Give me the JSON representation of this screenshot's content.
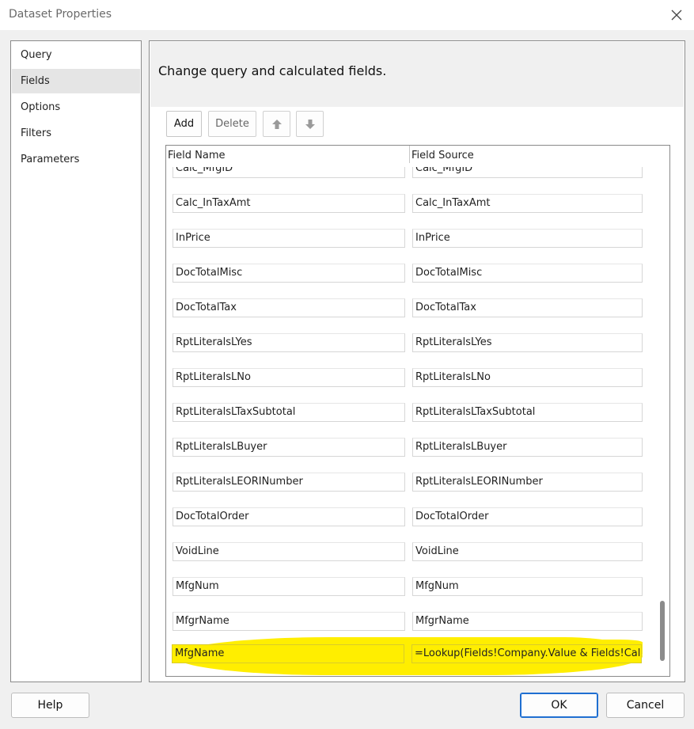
{
  "window": {
    "title": "Dataset Properties"
  },
  "nav": {
    "items": [
      {
        "label": "Query"
      },
      {
        "label": "Fields",
        "selected": true
      },
      {
        "label": "Options"
      },
      {
        "label": "Filters"
      },
      {
        "label": "Parameters"
      }
    ]
  },
  "panel": {
    "header": "Change query and calculated fields."
  },
  "toolbar": {
    "add_label": "Add",
    "delete_label": "Delete",
    "move_up_icon": "arrow-up-icon",
    "move_down_icon": "arrow-down-icon"
  },
  "grid": {
    "columns": {
      "name": "Field Name",
      "source": "Field Source"
    },
    "rows": [
      {
        "name": "Calc_MfgID",
        "source": "Calc_MfgID"
      },
      {
        "name": "Calc_InTaxAmt",
        "source": "Calc_InTaxAmt"
      },
      {
        "name": "InPrice",
        "source": "InPrice"
      },
      {
        "name": "DocTotalMisc",
        "source": "DocTotalMisc"
      },
      {
        "name": "DocTotalTax",
        "source": "DocTotalTax"
      },
      {
        "name": "RptLiteralsLYes",
        "source": "RptLiteralsLYes"
      },
      {
        "name": "RptLiteralsLNo",
        "source": "RptLiteralsLNo"
      },
      {
        "name": "RptLiteralsLTaxSubtotal",
        "source": "RptLiteralsLTaxSubtotal"
      },
      {
        "name": "RptLiteralsLBuyer",
        "source": "RptLiteralsLBuyer"
      },
      {
        "name": "RptLiteralsLEORINumber",
        "source": "RptLiteralsLEORINumber"
      },
      {
        "name": "DocTotalOrder",
        "source": "DocTotalOrder"
      },
      {
        "name": "VoidLine",
        "source": "VoidLine"
      },
      {
        "name": "MfgNum",
        "source": "MfgNum"
      },
      {
        "name": "MfgrName",
        "source": "MfgrName"
      },
      {
        "name": "MfgName",
        "source": "=Lookup(Fields!Company.Value & Fields!Calc_M",
        "highlighted": true
      }
    ]
  },
  "buttons": {
    "help": "Help",
    "ok": "OK",
    "cancel": "Cancel"
  },
  "colors": {
    "highlight": "#ffee00",
    "accent": "#1f6fd1"
  }
}
